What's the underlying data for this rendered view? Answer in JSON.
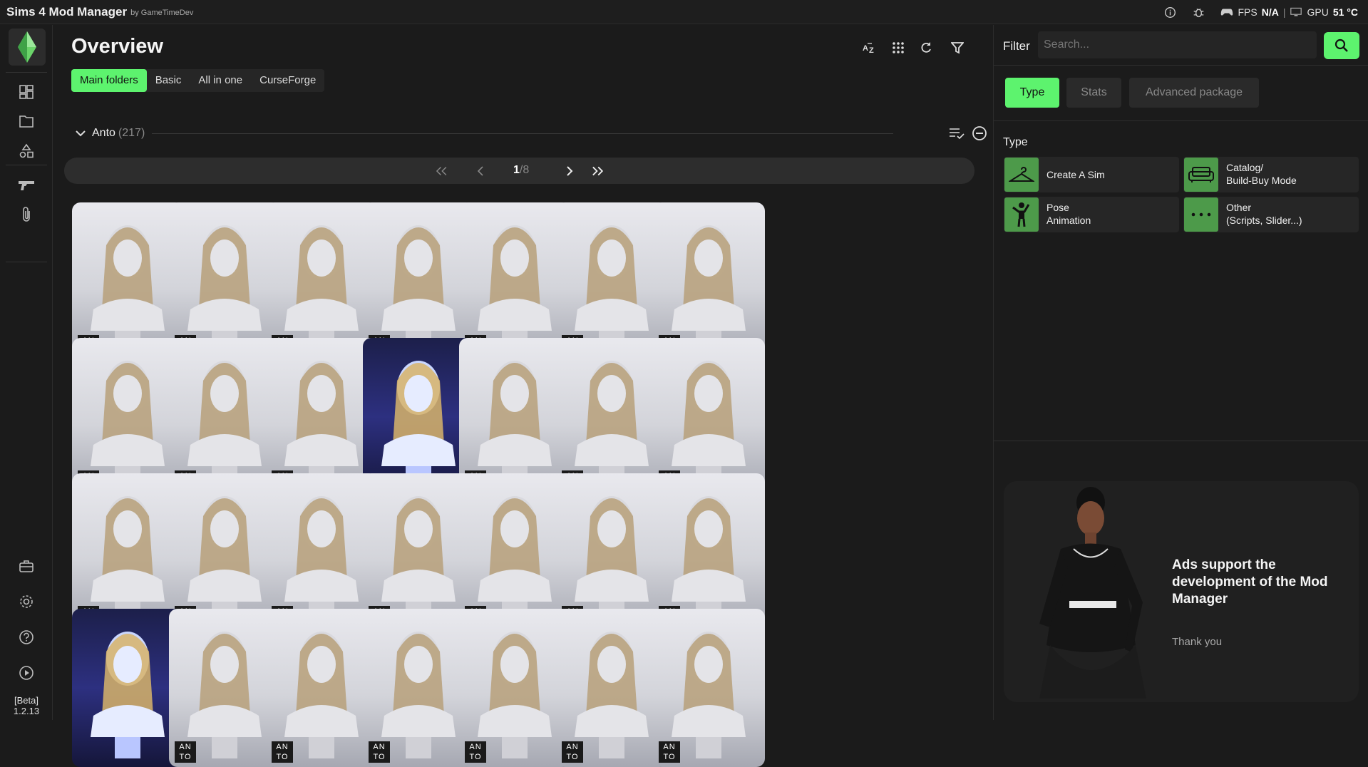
{
  "window": {
    "title": "Sims 4 Mod Manager",
    "by": "by GameTimeDev",
    "fps_label": "FPS",
    "fps_value": "N/A",
    "separator": "|",
    "gpu_label": "GPU",
    "gpu_value": "51 °C"
  },
  "sidebar": {
    "items": [
      "dashboard-icon",
      "folder-icon",
      "shapes-icon",
      "gun-icon",
      "paperclip-icon",
      "toolbox-icon",
      "gear-icon",
      "help-icon",
      "play-icon"
    ],
    "version_tag": "[Beta]",
    "version": "1.2.13"
  },
  "main": {
    "title": "Overview",
    "tabs": [
      {
        "label": "Main folders",
        "active": true
      },
      {
        "label": "Basic",
        "active": false
      },
      {
        "label": "All in one",
        "active": false
      },
      {
        "label": "CurseForge",
        "active": false
      }
    ],
    "section": {
      "name": "Anto",
      "count": "(217)"
    },
    "pager": {
      "current": "1",
      "total": "/8"
    },
    "card_brand": "AN TO"
  },
  "filter": {
    "label": "Filter",
    "search_placeholder": "Search...",
    "tabs": [
      {
        "label": "Type",
        "active": true
      },
      {
        "label": "Stats",
        "active": false
      },
      {
        "label": "Advanced package",
        "active": false
      }
    ],
    "type_title": "Type",
    "types": [
      {
        "line1": "Create A Sim",
        "line2": "",
        "icon": "hanger-icon"
      },
      {
        "line1": "Catalog/",
        "line2": "Build-Buy Mode",
        "icon": "sofa-icon"
      },
      {
        "line1": "Pose",
        "line2": "Animation",
        "icon": "person-icon"
      },
      {
        "line1": "Other",
        "line2": "(Scripts, Slider...)",
        "icon": "dots-icon"
      }
    ]
  },
  "ad": {
    "title": "Ads support the development of the Mod Manager",
    "thanks": "Thank you"
  },
  "colors": {
    "accent": "#5df36e",
    "type_icon_bg": "#4d9a4a",
    "background": "#1b1b1b"
  }
}
